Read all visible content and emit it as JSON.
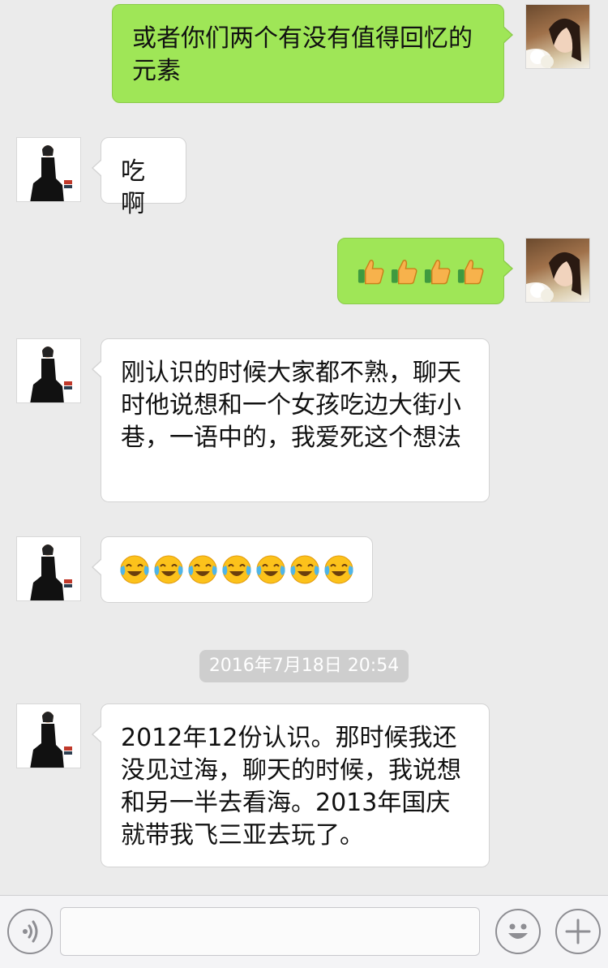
{
  "messages": [
    {
      "sender": "me",
      "text": "或者你们两个有没有值得回忆的元素"
    },
    {
      "sender": "friend",
      "text": "吃啊"
    },
    {
      "sender": "me",
      "emoji": "thumbs-up",
      "emoji_count": 4
    },
    {
      "sender": "friend",
      "text": "刚认识的时候大家都不熟，聊天时他说想和一个女孩吃边大街小巷，一语中的，我爱死这个想法"
    },
    {
      "sender": "friend",
      "emoji": "tears-of-joy",
      "emoji_count": 7
    },
    {
      "sender": "friend",
      "text": "2012年12份认识。那时候我还没见过海，聊天的时候，我说想和另一半去看海。2013年国庆就带我飞三亚去玩了。"
    }
  ],
  "timestamp": "2016年7月18日 20:54",
  "input": {
    "value": "",
    "placeholder": ""
  },
  "icons": {
    "voice": "voice-icon",
    "emoji": "smiley-icon",
    "more": "plus-icon"
  },
  "colors": {
    "my_bubble": "#9fe657",
    "friend_bubble": "#ffffff",
    "background": "#ebebeb"
  }
}
